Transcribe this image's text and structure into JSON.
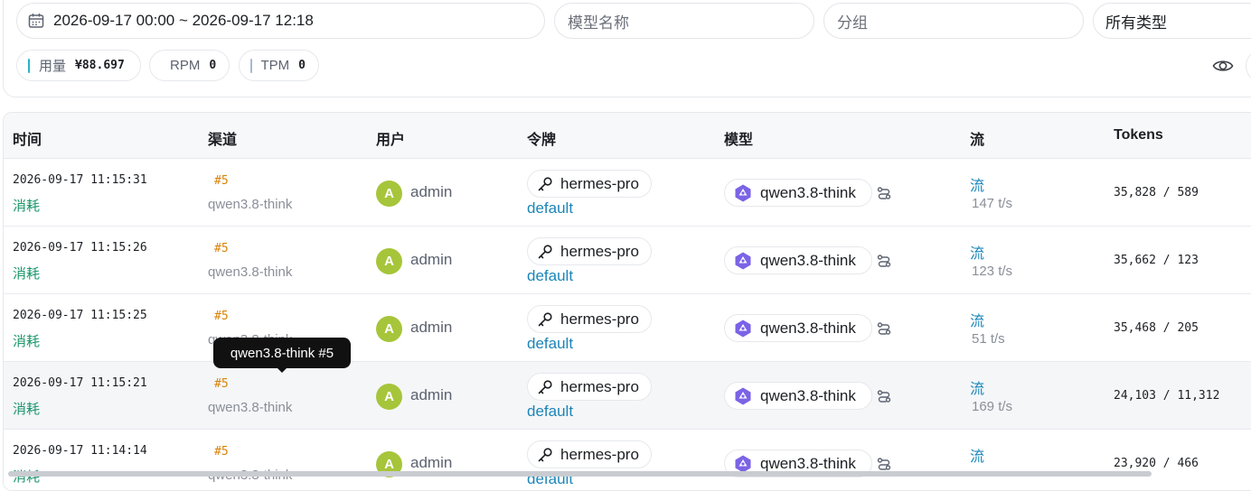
{
  "filters": {
    "date_range": "2026-09-17 00:00 ~ 2026-09-17 12:18",
    "model_placeholder": "模型名称",
    "group_placeholder": "分组",
    "type_select": "所有类型"
  },
  "stats": {
    "usage_label": "用量",
    "usage_value": "¥88.697",
    "rpm_label": "RPM",
    "rpm_value": "0",
    "tpm_label": "TPM",
    "tpm_value": "0",
    "colors": {
      "usage": "#2bb3c7",
      "rpm": "#e0556f",
      "tpm": "#a9b7d6"
    }
  },
  "table": {
    "headers": [
      "时间",
      "渠道",
      "用户",
      "令牌",
      "模型",
      "流",
      "Tokens"
    ],
    "rows": [
      {
        "time": "2026-09-17 11:15:31",
        "type": "消耗",
        "channel_id": "#5",
        "channel_name": "qwen3.8-think",
        "avatar": "A",
        "user": "admin",
        "token": "hermes-pro",
        "group": "default",
        "model": "qwen3.8-think",
        "stream": "流",
        "speed": "147 t/s",
        "tokens": "35,828 / 589"
      },
      {
        "time": "2026-09-17 11:15:26",
        "type": "消耗",
        "channel_id": "#5",
        "channel_name": "qwen3.8-think",
        "avatar": "A",
        "user": "admin",
        "token": "hermes-pro",
        "group": "default",
        "model": "qwen3.8-think",
        "stream": "流",
        "speed": "123 t/s",
        "tokens": "35,662 / 123"
      },
      {
        "time": "2026-09-17 11:15:25",
        "type": "消耗",
        "channel_id": "#5",
        "channel_name": "qwen3.8-think",
        "avatar": "A",
        "user": "admin",
        "token": "hermes-pro",
        "group": "default",
        "model": "qwen3.8-think",
        "stream": "流",
        "speed": "51 t/s",
        "tokens": "35,468 / 205"
      },
      {
        "time": "2026-09-17 11:15:21",
        "type": "消耗",
        "channel_id": "#5",
        "channel_name": "qwen3.8-think",
        "avatar": "A",
        "user": "admin",
        "token": "hermes-pro",
        "group": "default",
        "model": "qwen3.8-think",
        "stream": "流",
        "speed": "169 t/s",
        "tokens": "24,103 / 11,312"
      },
      {
        "time": "2026-09-17 11:14:14",
        "type": "消耗",
        "channel_id": "#5",
        "channel_name": "qwen3.8-think",
        "avatar": "A",
        "user": "admin",
        "token": "hermes-pro",
        "group": "default",
        "model": "qwen3.8-think",
        "stream": "流",
        "speed": "",
        "tokens": "23,920 / 466"
      }
    ]
  },
  "tooltip": {
    "text": "qwen3.8-think #5"
  },
  "icons": {
    "date": "calendar-icon",
    "visibility": "eye-icon",
    "token": "key-icon",
    "model": "qwen-logo-icon",
    "route": "route-icon"
  }
}
